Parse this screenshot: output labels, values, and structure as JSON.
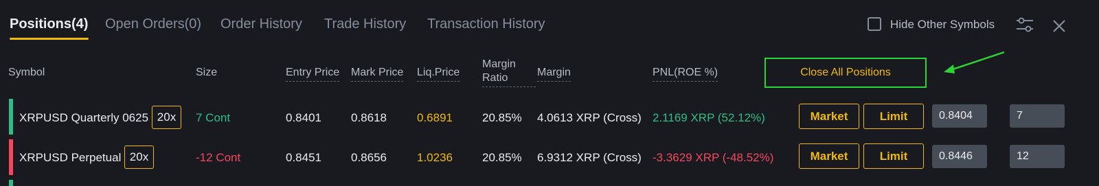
{
  "tabs": [
    {
      "label": "Positions(4)"
    },
    {
      "label": "Open Orders(0)"
    },
    {
      "label": "Order History"
    },
    {
      "label": "Trade History"
    },
    {
      "label": "Transaction History"
    }
  ],
  "tools": {
    "hide_other_symbols_label": "Hide Other Symbols",
    "hide_other_symbols_checked": false,
    "settings_icon": "sliders-icon",
    "close_icon": "close-icon"
  },
  "table": {
    "headers": {
      "symbol": "Symbol",
      "size": "Size",
      "entry_price": "Entry Price",
      "mark_price": "Mark Price",
      "liq_price": "Liq.Price",
      "margin_ratio_line1": "Margin",
      "margin_ratio_line2": "Ratio",
      "margin": "Margin",
      "pnl": "PNL(ROE %)",
      "close_all": "Close All Positions"
    },
    "rows": [
      {
        "symbol": "XRPUSD Quarterly 0625",
        "leverage": "20x",
        "size": "7 Cont",
        "entry_price": "0.8401",
        "mark_price": "0.8618",
        "liq_price": "0.6891",
        "margin_ratio": "20.85%",
        "margin": "4.0613 XRP (Cross)",
        "pnl": "2.1169 XRP (52.12%)",
        "market_label": "Market",
        "limit_label": "Limit",
        "price_input": "0.8404",
        "qty_input": "7"
      },
      {
        "symbol": "XRPUSD Perpetual",
        "leverage": "20x",
        "size": "-12 Cont",
        "entry_price": "0.8451",
        "mark_price": "0.8656",
        "liq_price": "1.0236",
        "margin_ratio": "20.85%",
        "margin": "6.9312 XRP (Cross)",
        "pnl": "-3.3629 XRP (-48.52%)",
        "market_label": "Market",
        "limit_label": "Limit",
        "price_input": "0.8446",
        "qty_input": "12"
      }
    ]
  },
  "colors": {
    "background": "#181a20",
    "accent": "#f0b90b",
    "profit": "#2ebd85",
    "loss": "#f6465d",
    "annotation": "#2bd633"
  }
}
